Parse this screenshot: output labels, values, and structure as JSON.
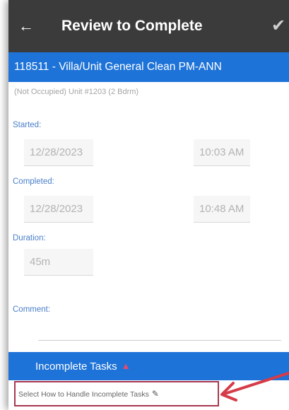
{
  "header": {
    "title": "Review to Complete",
    "back_icon": "arrow-left-icon",
    "confirm_icon": "check-icon"
  },
  "job": {
    "title": "118511 - Villa/Unit General Clean PM-ANN",
    "unit_info": "(Not Occupied) Unit #1203 (2 Bdrm)"
  },
  "started": {
    "label": "Started:",
    "date": "12/28/2023",
    "time": "10:03 AM"
  },
  "completed": {
    "label": "Completed:",
    "date": "12/28/2023",
    "time": "10:48 AM"
  },
  "duration": {
    "label": "Duration:",
    "value": "45m"
  },
  "comment": {
    "label": "Comment:",
    "value": ""
  },
  "incomplete_tasks": {
    "header": "Incomplete Tasks",
    "warning_icon": "warning-triangle-icon",
    "select_label": "Select How to Handle Incomplete Tasks",
    "edit_icon": "pencil-icon"
  },
  "colors": {
    "topbar": "#3b3b3b",
    "accent_blue": "#1e73d8",
    "label_blue": "#4a7fc9",
    "highlight_border": "#a8384f",
    "annotation_arrow": "#d63b48",
    "warning": "#e84a6b"
  }
}
